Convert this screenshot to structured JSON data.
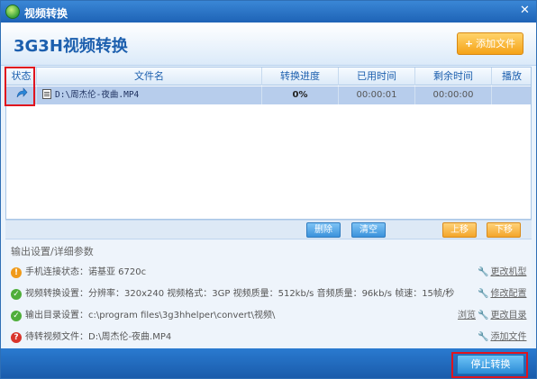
{
  "window": {
    "title": "视频转换"
  },
  "header": {
    "app_title": "3G3H视频转换",
    "add_file_label": "添加文件"
  },
  "table": {
    "columns": [
      "状态",
      "文件名",
      "转换进度",
      "已用时间",
      "剩余时间",
      "播放"
    ],
    "rows": [
      {
        "file": "D:\\周杰伦-夜曲.MP4",
        "progress": "0%",
        "elapsed": "00:00:01",
        "remaining": "00:00:00"
      }
    ]
  },
  "actions": {
    "delete": "删除",
    "clear": "清空",
    "up": "上移",
    "down": "下移"
  },
  "settings": {
    "title": "输出设置/详细参数",
    "rows": [
      {
        "text": "手机连接状态：诺基亚 6720c",
        "link": "更改机型",
        "status": "warn"
      },
      {
        "text": "视频转换设置：分辨率：320x240  视频格式：3GP 视频质量：512kb/s 音频质量：96kb/s  帧速：15帧/秒",
        "link": "修改配置",
        "status": "ok"
      },
      {
        "text": "输出目录设置：c:\\program files\\3g3hhelper\\convert\\视频\\",
        "browse": "浏览",
        "link": "更改目录",
        "status": "ok"
      },
      {
        "text": "待转视频文件：D:\\周杰伦-夜曲.MP4",
        "link": "添加文件",
        "status": "err"
      }
    ]
  },
  "footer": {
    "stop_label": "停止转换"
  },
  "colors": {
    "accent": "#1c5fae",
    "highlight": "#e0141e",
    "orange": "#f5a317"
  }
}
